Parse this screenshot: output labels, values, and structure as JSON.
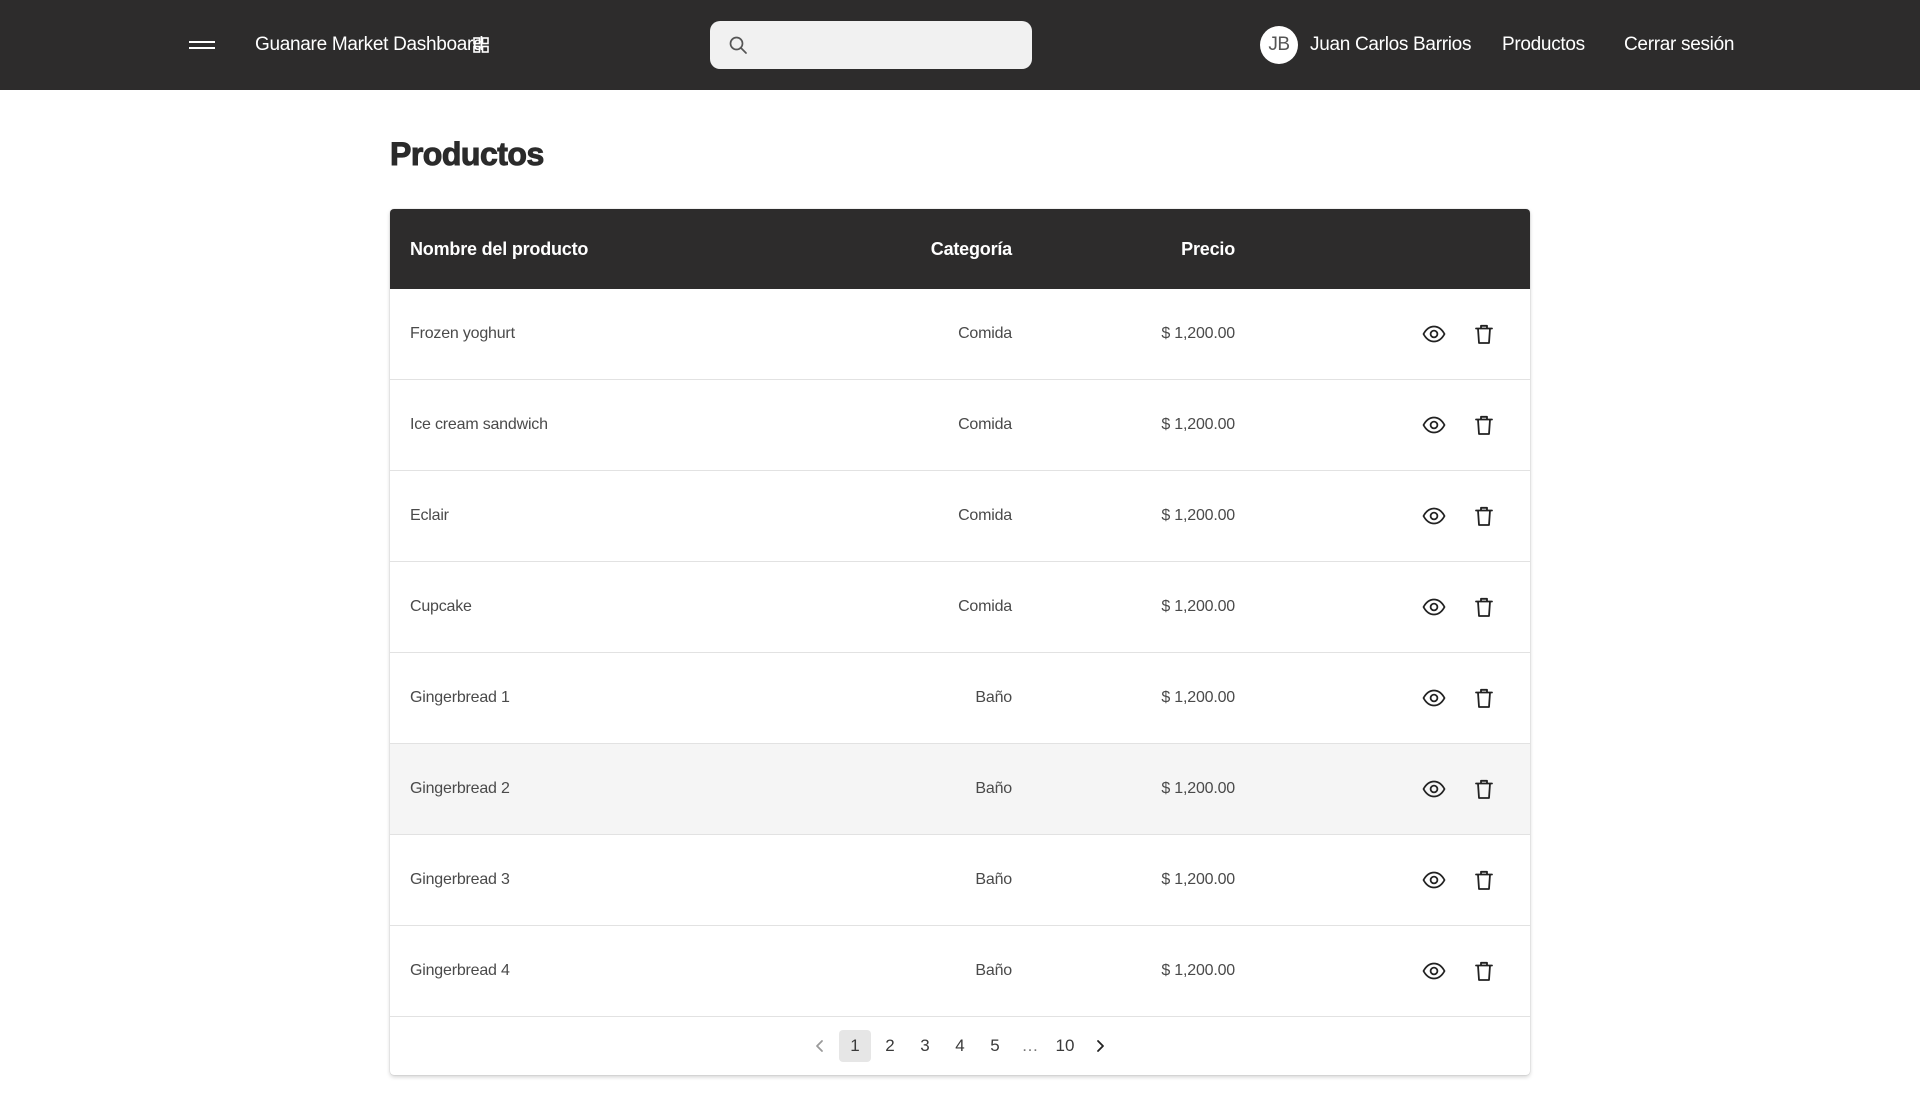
{
  "header": {
    "app_title": "Guanare Market Dashboard",
    "search": {
      "value": "",
      "placeholder": ""
    },
    "user": {
      "initials": "JB",
      "name": "Juan Carlos Barrios"
    },
    "nav": {
      "products_label": "Productos",
      "logout_label": "Cerrar sesión"
    },
    "colors": {
      "background": "#2d2c2c",
      "text": "#ffffff"
    }
  },
  "page": {
    "title": "Productos"
  },
  "table": {
    "columns": {
      "name": "Nombre del producto",
      "category": "Categoría",
      "price": "Precio"
    },
    "rows": [
      {
        "name": "Frozen yoghurt",
        "category": "Comida",
        "price": "$ 1,200.00"
      },
      {
        "name": "Ice cream sandwich",
        "category": "Comida",
        "price": "$ 1,200.00"
      },
      {
        "name": "Eclair",
        "category": "Comida",
        "price": "$ 1,200.00"
      },
      {
        "name": "Cupcake",
        "category": "Comida",
        "price": "$ 1,200.00"
      },
      {
        "name": "Gingerbread 1",
        "category": "Baño",
        "price": "$ 1,200.00"
      },
      {
        "name": "Gingerbread 2",
        "category": "Baño",
        "price": "$ 1,200.00",
        "hovered": true
      },
      {
        "name": "Gingerbread 3",
        "category": "Baño",
        "price": "$ 1,200.00"
      },
      {
        "name": "Gingerbread 4",
        "category": "Baño",
        "price": "$ 1,200.00"
      }
    ],
    "row_actions": [
      "eye-icon",
      "trash-icon"
    ]
  },
  "pagination": {
    "pages": [
      "1",
      "2",
      "3",
      "4",
      "5",
      "…",
      "10"
    ],
    "current": "1"
  }
}
